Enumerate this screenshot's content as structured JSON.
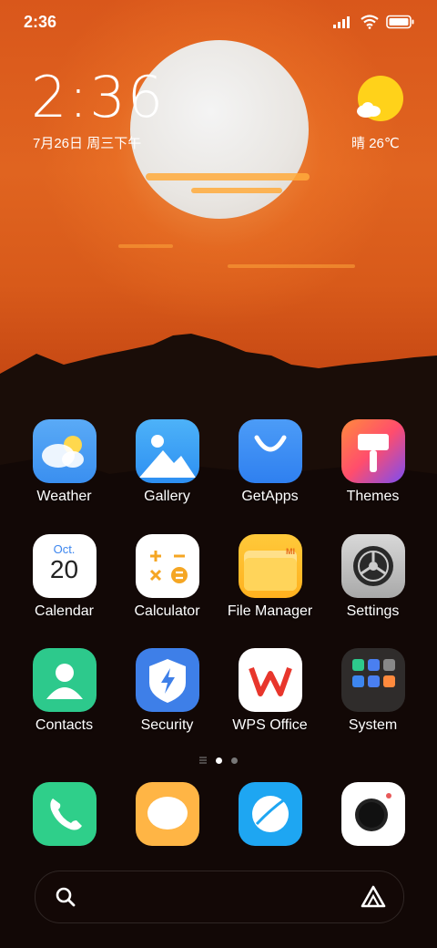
{
  "status_bar": {
    "time": "2:36"
  },
  "clock_widget": {
    "time": "2:36",
    "date": "7月26日 周三下午"
  },
  "weather_widget": {
    "condition": "晴",
    "temperature": "26℃"
  },
  "apps": [
    {
      "label": "Weather"
    },
    {
      "label": "Gallery"
    },
    {
      "label": "GetApps"
    },
    {
      "label": "Themes"
    },
    {
      "label": "Calendar",
      "month": "Oct.",
      "day": "20"
    },
    {
      "label": "Calculator"
    },
    {
      "label": "File Manager"
    },
    {
      "label": "Settings"
    },
    {
      "label": "Contacts"
    },
    {
      "label": "Security"
    },
    {
      "label": "WPS Office"
    },
    {
      "label": "System"
    }
  ],
  "file_manager_badge": "MI",
  "dock": [
    "phone-icon",
    "messages-icon",
    "browser-icon",
    "camera-icon"
  ],
  "colors": {
    "weather": "#4a9ff3",
    "gallery": "#3aa0f5",
    "getapps": "#3d8ef5",
    "contacts": "#2dc98c",
    "security": "#3e7fe8",
    "phone": "#2fcf8a",
    "messages": "#ffb545",
    "browser": "#1ea6f2"
  }
}
